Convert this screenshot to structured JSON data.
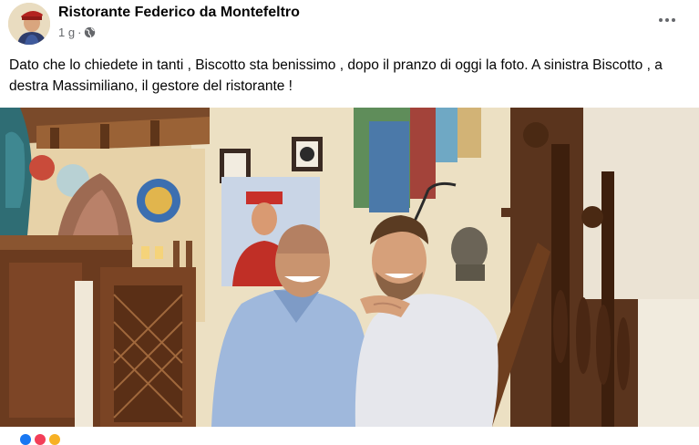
{
  "post": {
    "page_name": "Ristorante Federico da Montefeltro",
    "time": "1 g",
    "separator": "·",
    "audience_icon": "globe-icon",
    "more_icon": "more-options-icon",
    "caption": "Dato che lo chiedete in tanti , Biscotto sta benissimo , dopo il pranzo di oggi la foto. A sinistra Biscotto , a destra  Massimiliano, il gestore del ristorante !",
    "photo_icon": "post-photo"
  },
  "colors": {
    "text": "#050505",
    "secondary_text": "#65676b",
    "reaction_like": "#1877f2",
    "reaction_love": "#f33e58",
    "reaction_haha": "#f7b125"
  }
}
